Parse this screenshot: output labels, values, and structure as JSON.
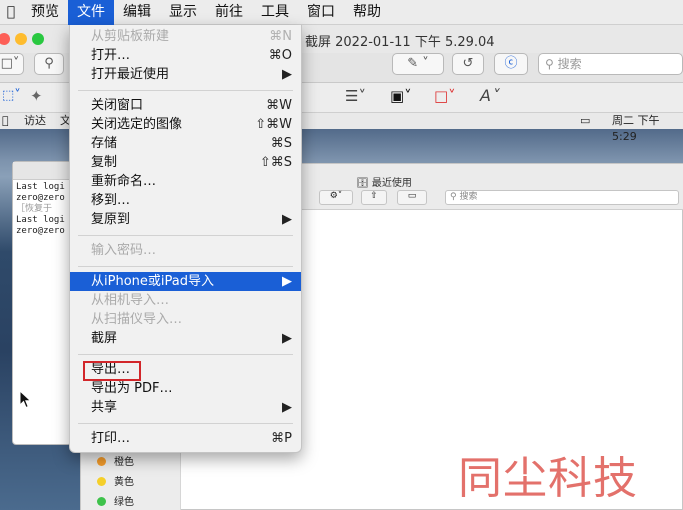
{
  "menubar": {
    "items": [
      "预览",
      "文件",
      "编辑",
      "显示",
      "前往",
      "工具",
      "窗口",
      "帮助"
    ],
    "active": "文件"
  },
  "preview": {
    "title": "截屏 2022-01-11 下午 5.29.04",
    "search_placeholder": "搜索"
  },
  "shot": {
    "menubar_items": [
      "访达",
      "文"
    ],
    "clock": "周二 下午 5:29",
    "terminal_lines": [
      "Last logi",
      "zero@zero",
      "［恢复于",
      "Last logi",
      "zero@zero"
    ],
    "finder_title": "最近使用",
    "finder_search": "搜索",
    "tags": [
      {
        "label": "橙色",
        "color": "#f39c2c"
      },
      {
        "label": "黄色",
        "color": "#f5cf2a"
      },
      {
        "label": "绿色",
        "color": "#3ec24b"
      }
    ]
  },
  "file_menu": {
    "new_from_clipboard": {
      "label": "从剪贴板新建",
      "shortcut": "⌘N"
    },
    "open": {
      "label": "打开…",
      "shortcut": "⌘O"
    },
    "open_recent": {
      "label": "打开最近使用",
      "shortcut": "▶"
    },
    "close_window": {
      "label": "关闭窗口",
      "shortcut": "⌘W"
    },
    "close_selected": {
      "label": "关闭选定的图像",
      "shortcut": "⇧⌘W"
    },
    "save": {
      "label": "存储",
      "shortcut": "⌘S"
    },
    "duplicate": {
      "label": "复制",
      "shortcut": "⇧⌘S"
    },
    "rename": {
      "label": "重新命名…"
    },
    "move_to": {
      "label": "移到…"
    },
    "revert_to": {
      "label": "复原到",
      "shortcut": "▶"
    },
    "enter_password": {
      "label": "输入密码…"
    },
    "import_iphone": {
      "label": "从iPhone或iPad导入",
      "shortcut": "▶"
    },
    "import_camera": {
      "label": "从相机导入…"
    },
    "import_scanner": {
      "label": "从扫描仪导入…"
    },
    "screenshot": {
      "label": "截屏",
      "shortcut": "▶"
    },
    "export": {
      "label": "导出…"
    },
    "export_pdf": {
      "label": "导出为 PDF…"
    },
    "share": {
      "label": "共享",
      "shortcut": "▶"
    },
    "print": {
      "label": "打印…",
      "shortcut": "⌘P"
    }
  },
  "watermark": "同尘科技",
  "colors": {
    "accent": "#1a5fd6",
    "highlight_box": "#d2262a",
    "watermark": "#e3716b"
  }
}
